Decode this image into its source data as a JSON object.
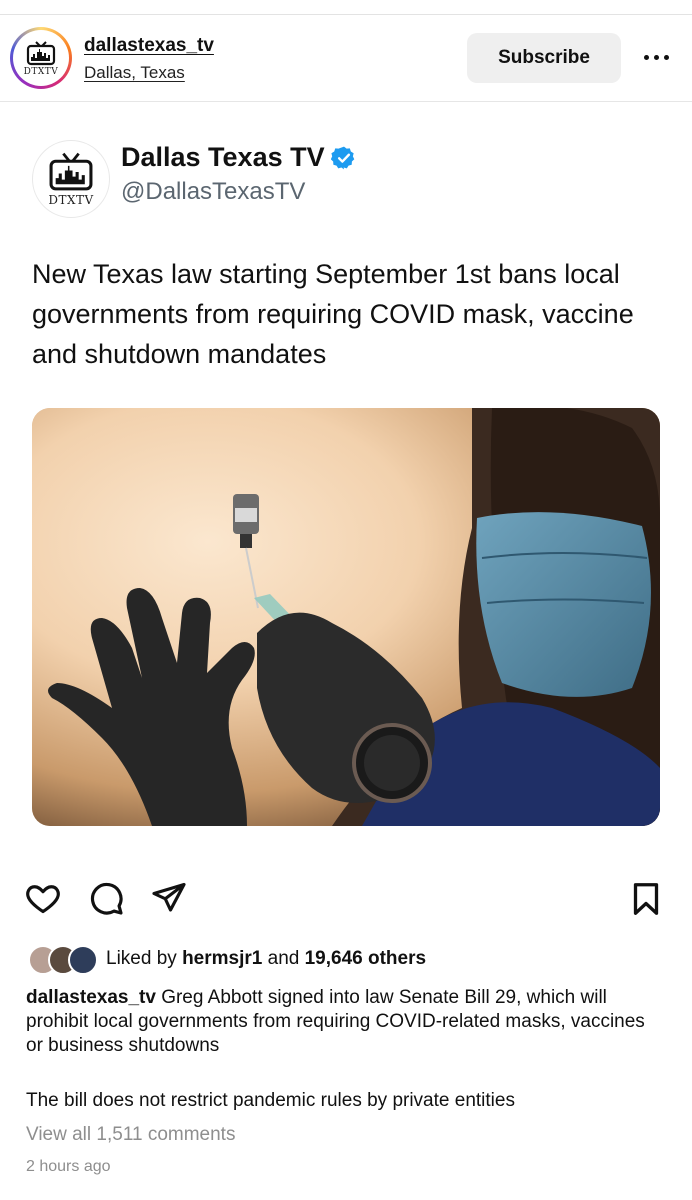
{
  "header": {
    "username": "dallastexas_tv",
    "location": "Dallas, Texas",
    "subscribe_label": "Subscribe",
    "logo_text": "DTXTV"
  },
  "tweet": {
    "display_name": "Dallas Texas TV",
    "handle": "@DallasTexasTV",
    "logo_text": "DTXTV",
    "text": "New Texas law starting September 1st bans local governments from requiring COVID mask, vaccine and shutdown mandates",
    "verified_color": "#1d9bf0"
  },
  "icons": [
    "heart-icon",
    "comment-icon",
    "share-icon",
    "bookmark-icon",
    "more-icon",
    "verified-badge-icon"
  ],
  "likes": {
    "prefix": "Liked by",
    "user": "hermsjr1",
    "middle": "and",
    "count": "19,646 others"
  },
  "caption": {
    "username": "dallastexas_tv",
    "text": "Greg Abbott signed into law Senate Bill 29, which will prohibit local governments from requiring COVID-related masks, vaccines or business shutdowns",
    "text2": "The bill does not restrict pandemic rules by private entities"
  },
  "comments": {
    "view_all": "View all 1,511 comments"
  },
  "timestamp": "2 hours ago"
}
